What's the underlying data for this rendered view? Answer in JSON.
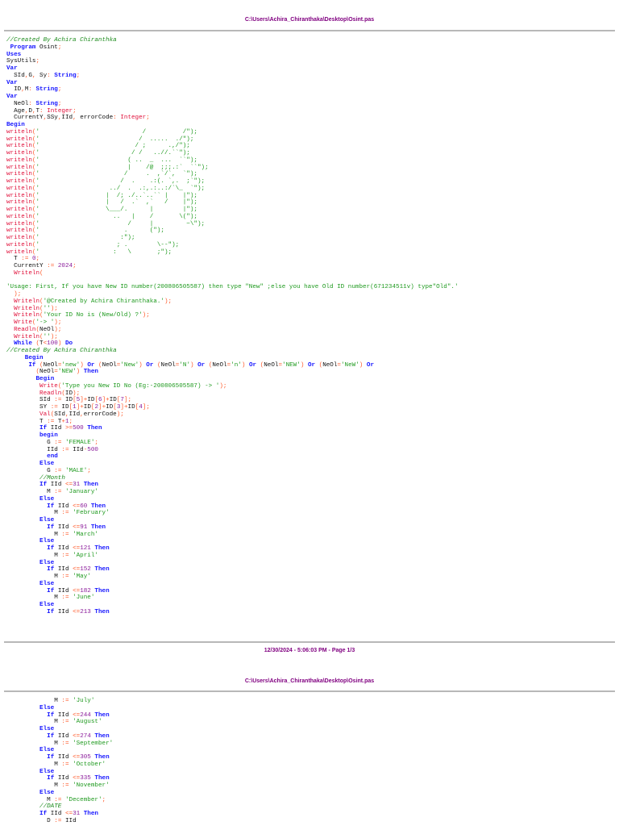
{
  "page1": {
    "header_path": "C:\\Users\\Achira_Chiranthaka\\Desktop\\Osint.pas",
    "footer": "12/30/2024 - 5:06:03 PM - Page 1/3",
    "lines": [
      "//Created By Achira Chiranthka",
      " Program Osint;",
      "Uses",
      "SysUtils;",
      "Var",
      "  SId,G, Sy: String;",
      "Var",
      "  ID,M: String;",
      "Var",
      "  NeOl: String;",
      "  Age,D,T: Integer;",
      "  CurrentY,SSy,IId, errorCode: Integer;",
      "Begin",
      "writeln('                            /          /\");",
      "writeln('                           /  .....  ./\");",
      "writeln('                          / ;      .,/\");",
      "writeln('                         / /   ..//.``\");",
      "writeln('                        ( ..  _  ...  ``\");",
      "writeln('                        |    /@  ;;;.:`  ``\");",
      "writeln('                       /     .  ,`/`,  `\");",
      "writeln('                      /  .    .:(. `,.  ;`\");",
      "writeln('                   ../  .  .:,.:..:/`\\_  `\");",
      "writeln('                  |  /; ./..`..`` |    |\");",
      "writeln('                  |   /  .`  ,`   /    |\");",
      "writeln('                  \\___/.      |        |\");",
      "writeln('                    ..   |    /       \\(\");",
      "writeln('                        /     |         ~\\\");",
      "writeln('                       .      (\");",
      "writeln('                      :\");",
      "writeln('                     ; .        \\--\");",
      "writeln('                    :   \\       ;\");",
      "  T := 0;",
      "  CurrentY := 2024;",
      "  Writeln(",
      "",
      "'Usage: First, If you have New ID number(200806505587) then type \"New\" ;else you have Old ID number(671234511v) type\"Old\".'",
      "  );",
      "  Writeln('@Created by Achira Chiranthaka.');",
      "  Writeln('');",
      "  Writeln('Your ID No is (New/Old) ?');",
      "  Write('-> ');",
      "  Readln(NeOl);",
      "  Writeln('');",
      "  While (T<100) Do",
      "//Created By Achira Chiranthka",
      "     Begin",
      "      If (NeOl='new') Or (NeOl='New') Or (NeOl='N') Or (NeOl='n') Or (NeOl='NEW') Or (NeOl='NeW') Or",
      "        (NeOl='NEW') Then",
      "        Begin",
      "         Write('Type you New ID No (Eg:-200806505587) -> ');",
      "         Readln(ID);",
      "         SId := ID[5]+ID[6]+ID[7];",
      "         SY := ID[1]+ID[2]+ID[3]+ID[4];",
      "         Val(SId,IId,errorCode);",
      "         T := T+1;",
      "         If IId >=500 Then",
      "         begin",
      "           G := 'FEMALE';",
      "           IId := IId-500",
      "           end",
      "         Else",
      "           G := 'MALE';",
      "         //Month",
      "         If IId <=31 Then",
      "           M := 'January'",
      "         Else",
      "           If IId <=60 Then",
      "             M := 'February'",
      "         Else",
      "           If IId <=91 Then",
      "             M := 'March'",
      "         Else",
      "           If IId <=121 Then",
      "             M := 'April'",
      "         Else",
      "           If IId <=152 Then",
      "             M := 'May'",
      "         Else",
      "           If IId <=182 Then",
      "             M := 'June'",
      "         Else",
      "           If IId <=213 Then"
    ]
  },
  "page2": {
    "header_path": "C:\\Users\\Achira_Chiranthaka\\Desktop\\Osint.pas",
    "lines": [
      "             M := 'July'",
      "         Else",
      "           If IId <=244 Then",
      "             M := 'August'",
      "         Else",
      "           If IId <=274 Then",
      "             M := 'September'",
      "         Else",
      "           If IId <=305 Then",
      "             M := 'October'",
      "         Else",
      "           If IId <=335 Then",
      "             M := 'November'",
      "         Else",
      "           M := 'December';",
      "         //DATE",
      "         If IId <=31 Then",
      "           D := IId"
    ]
  }
}
